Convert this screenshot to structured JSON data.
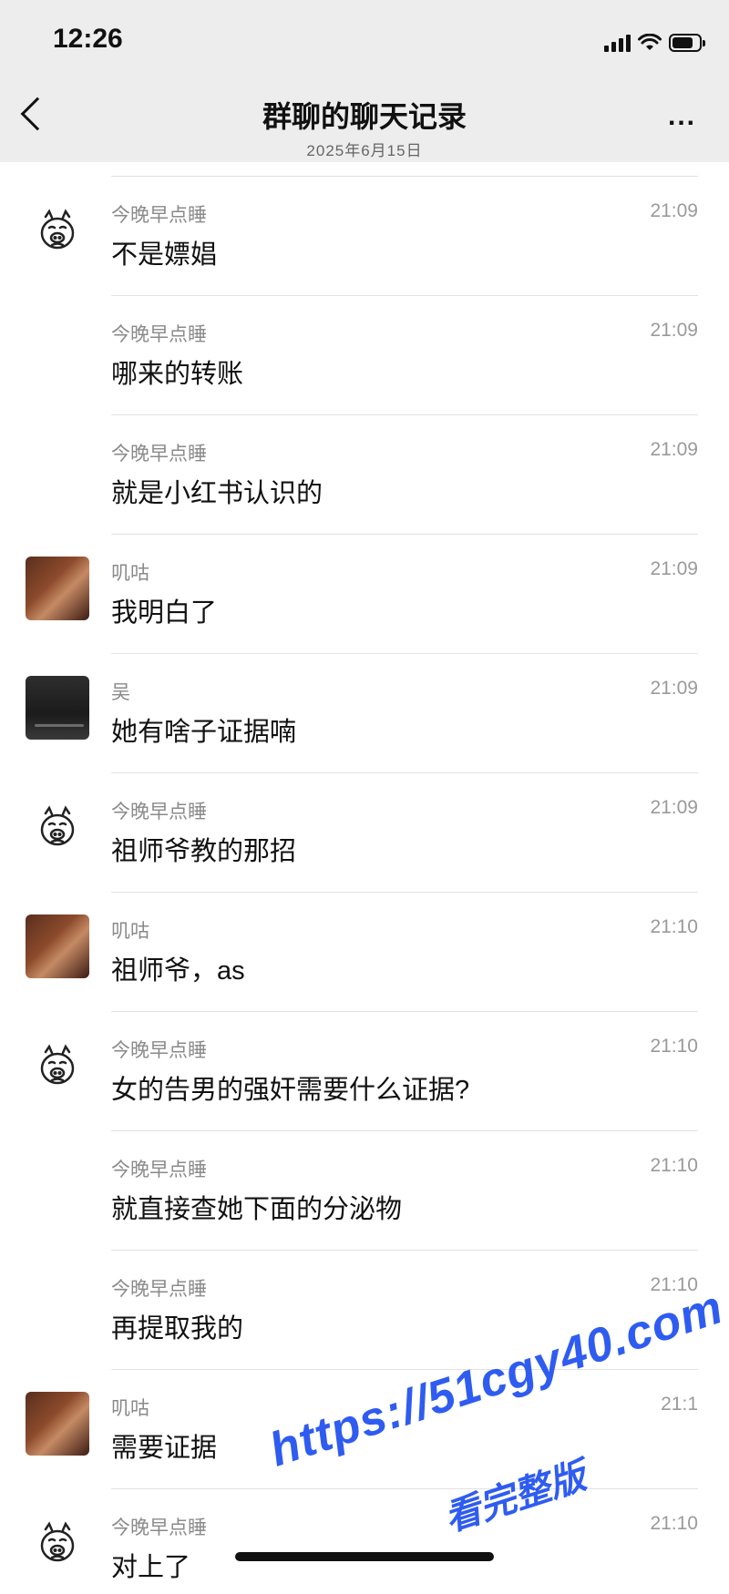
{
  "status_bar": {
    "time": "12:26",
    "icons": [
      "cellular-signal-icon",
      "wifi-icon",
      "battery-icon"
    ]
  },
  "nav": {
    "back_icon": "chevron-left-icon",
    "title": "群聊的聊天记录",
    "subtitle": "2025年6月15日",
    "more_icon": "more-horizontal-icon",
    "more_label": "..."
  },
  "messages": [
    {
      "sender": "今晚早点睡",
      "time": "21:09",
      "text": "不是嫖娼",
      "avatar": "pig"
    },
    {
      "sender": "今晚早点睡",
      "time": "21:09",
      "text": "哪来的转账",
      "avatar": "none"
    },
    {
      "sender": "今晚早点睡",
      "time": "21:09",
      "text": "就是小红书认识的",
      "avatar": "none"
    },
    {
      "sender": "叽咕",
      "time": "21:09",
      "text": "我明白了",
      "avatar": "photo"
    },
    {
      "sender": "吴",
      "time": "21:09",
      "text": "她有啥子证据喃",
      "avatar": "dark"
    },
    {
      "sender": "今晚早点睡",
      "time": "21:09",
      "text": "祖师爷教的那招",
      "avatar": "pig"
    },
    {
      "sender": "叽咕",
      "time": "21:10",
      "text": "祖师爷，as",
      "avatar": "photo"
    },
    {
      "sender": "今晚早点睡",
      "time": "21:10",
      "text": "女的告男的强奸需要什么证据?",
      "avatar": "pig"
    },
    {
      "sender": "今晚早点睡",
      "time": "21:10",
      "text": "就直接查她下面的分泌物",
      "avatar": "none"
    },
    {
      "sender": "今晚早点睡",
      "time": "21:10",
      "text": "再提取我的",
      "avatar": "none"
    },
    {
      "sender": "叽咕",
      "time": "21:1",
      "text": "需要证据",
      "avatar": "photo"
    },
    {
      "sender": "今晚早点睡",
      "time": "21:10",
      "text": "对上了",
      "avatar": "pig"
    }
  ],
  "watermark": {
    "line1": "https://51cgy40.com",
    "line2": "看完整版"
  },
  "colors": {
    "nav_bg": "#ededed",
    "watermark": "#2f5cf0",
    "sender_text": "#8a8a8a",
    "divider": "#e2e2e2"
  }
}
